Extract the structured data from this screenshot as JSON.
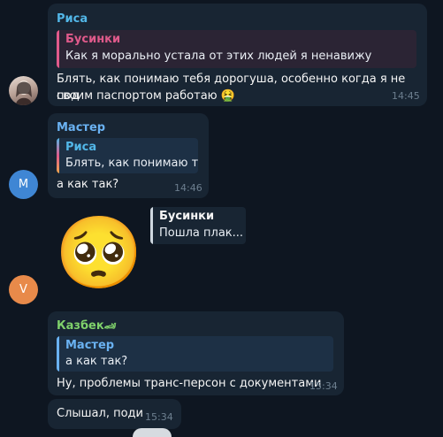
{
  "messages": [
    {
      "sender": "Риса",
      "reply": {
        "name": "Бусинки",
        "text": "Как я морально устала от этих людей я ненавижу"
      },
      "text_line1": "Блять, как понимаю тебя дорогуша, особенно когда я не под",
      "text_line2": "своим паспортом работаю",
      "emoji": "🤮",
      "time": "14:45",
      "avatar_icon": "photo-avatar"
    },
    {
      "sender": "Мастер",
      "reply": {
        "name": "Риса",
        "text": "Блять, как понимаю т..."
      },
      "text": "а как так?",
      "time": "14:46",
      "avatar_letter": "М"
    },
    {
      "sticker_emoji": "🥺",
      "reply": {
        "name": "Бусинки",
        "text": "Пошла плак..."
      },
      "avatar_letter": "V"
    },
    {
      "sender": "Казбек",
      "sender_suffix": "🏎",
      "reply": {
        "name": "Мастер",
        "text": "а как так?"
      },
      "text": "Ну, проблемы транс-персон с документами",
      "time": "15:34"
    },
    {
      "text": "Слышал, поди",
      "time": "15:34"
    }
  ],
  "colors": {
    "background": "#0e1621",
    "bubble": "#182533",
    "risa": "#52b7e8",
    "businki": "#e05a8b",
    "master": "#6ab2f2",
    "kazbek": "#7fd16b",
    "time": "#6d7f8f"
  }
}
